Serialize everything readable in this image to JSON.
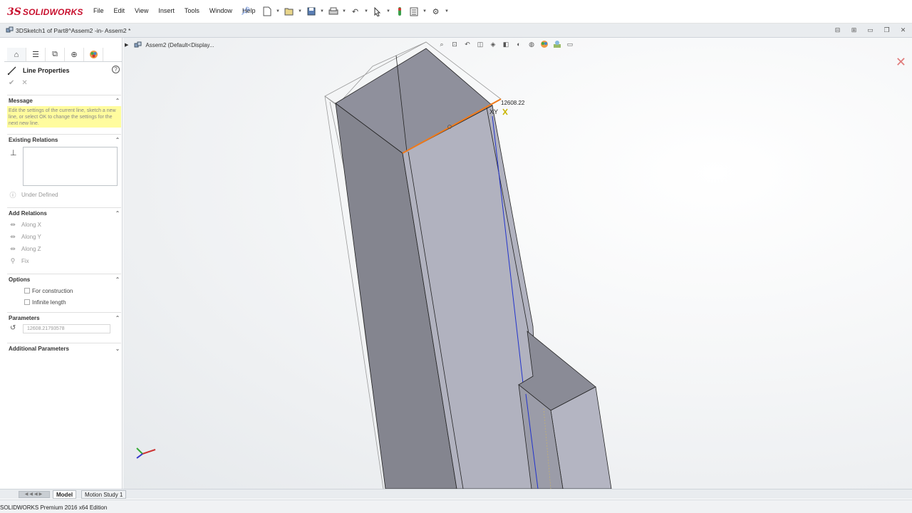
{
  "app": {
    "logo_ds": "3S",
    "logo_text": "SOLIDWORKS",
    "menus": [
      "File",
      "Edit",
      "View",
      "Insert",
      "Tools",
      "Window",
      "Help"
    ],
    "toolbar_icons": [
      "new-icon",
      "open-icon",
      "save-icon",
      "print-icon",
      "undo-icon",
      "select-icon",
      "rebuild-icon",
      "file-properties-icon",
      "options-icon"
    ]
  },
  "document": {
    "title": "3DSketch1 of Part8^Assem2 -in- Assem2 *"
  },
  "property_manager": {
    "title": "Line Properties",
    "message_section": "Message",
    "message_text": "Edit the settings of the current line, sketch a new line, or select OK to change the settings for the next new line.",
    "existing_relations_section": "Existing Relations",
    "status": "Under Defined",
    "add_relations_section": "Add Relations",
    "relations": [
      "Along X",
      "Along Y",
      "Along Z",
      "Fix"
    ],
    "options_section": "Options",
    "options": [
      "For construction",
      "Infinite length"
    ],
    "parameters_section": "Parameters",
    "length_value": "12608.21793578",
    "additional_section": "Additional Parameters"
  },
  "viewport": {
    "tree_item": "Assem2  (Default<Display...",
    "dimension_label": "12608.22",
    "axis_label": "XY"
  },
  "bottom": {
    "tabs": [
      "Model",
      "Motion Study 1"
    ],
    "status": "SOLIDWORKS Premium 2016 x64 Edition"
  }
}
